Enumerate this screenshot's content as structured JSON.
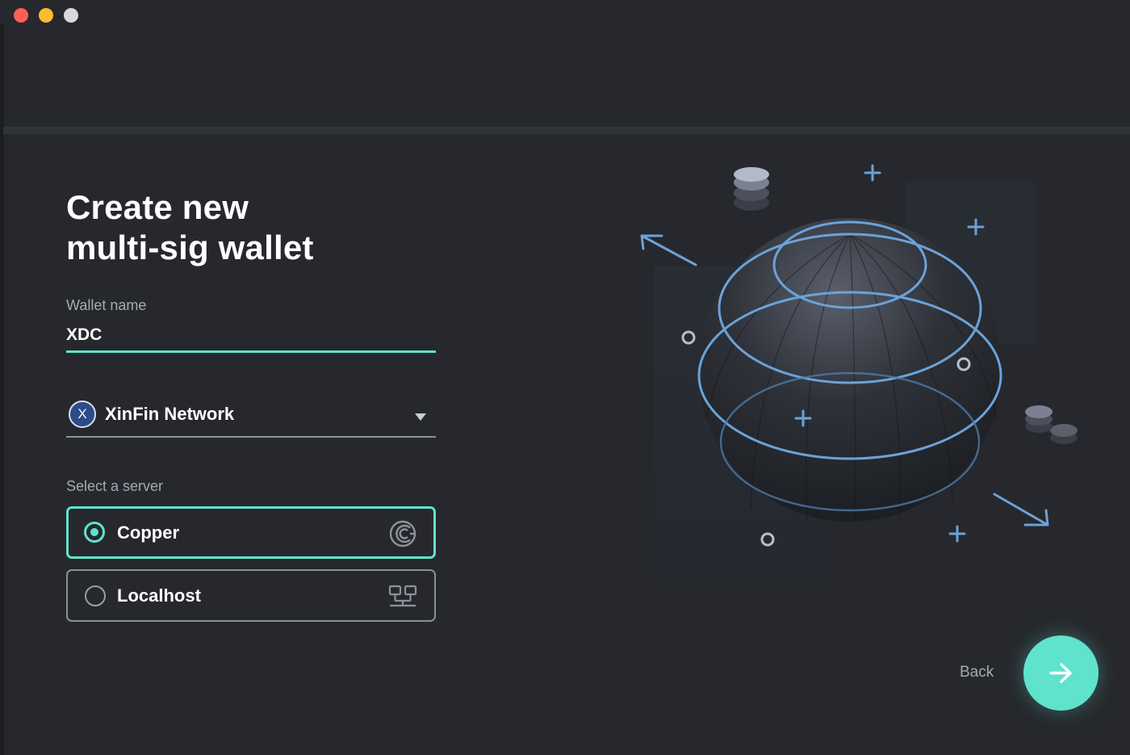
{
  "window": {
    "controls": [
      "close",
      "minimize",
      "zoom"
    ]
  },
  "page": {
    "title_line1": "Create new",
    "title_line2": "multi-sig wallet"
  },
  "wallet": {
    "label": "Wallet name",
    "value": "XDC"
  },
  "network": {
    "badge": "X",
    "selected": "XinFin Network"
  },
  "server": {
    "label": "Select a server",
    "options": [
      {
        "label": "Copper",
        "selected": true,
        "icon": "copper-logo-icon"
      },
      {
        "label": "Localhost",
        "selected": false,
        "icon": "network-nodes-icon"
      }
    ]
  },
  "nav": {
    "back_label": "Back",
    "next_icon": "arrow-right-icon"
  },
  "colors": {
    "accent": "#5fe3cc",
    "background": "#26282d",
    "illustration_line": "#6aa3d9"
  }
}
